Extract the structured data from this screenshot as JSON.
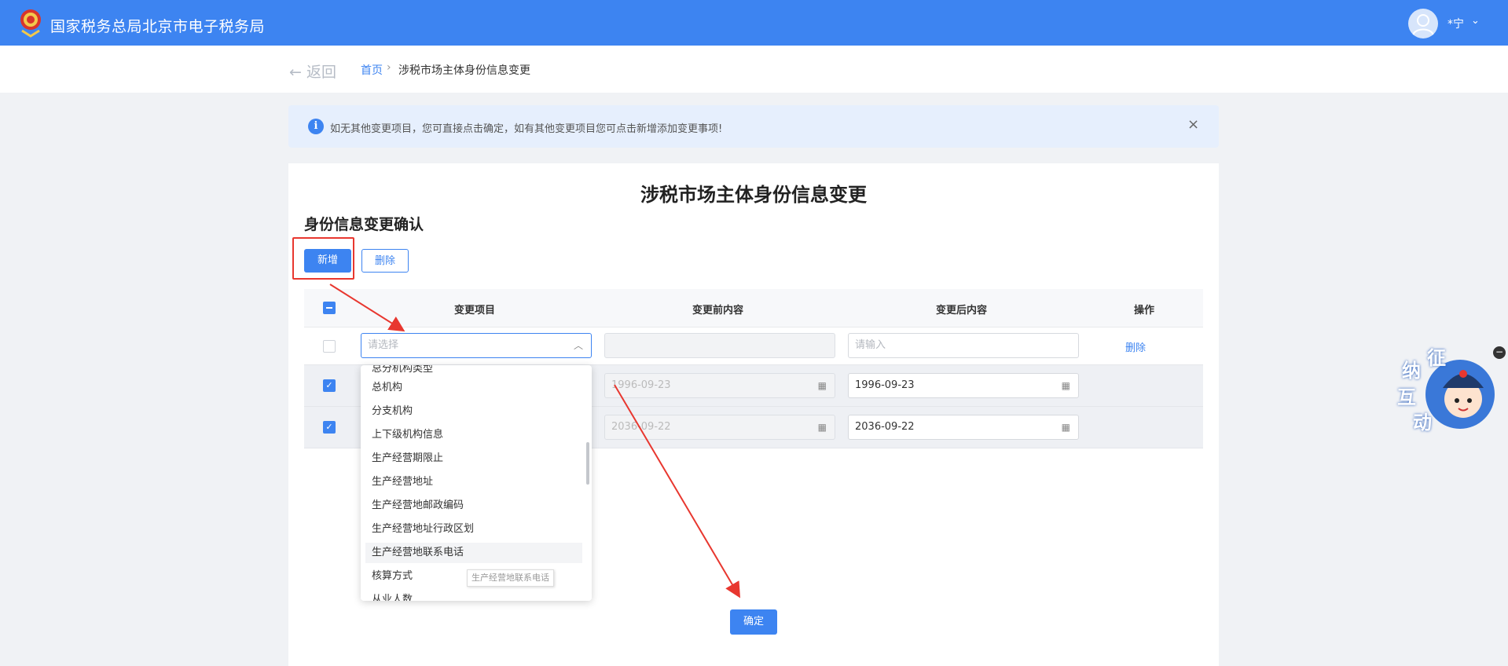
{
  "header": {
    "site_title": "国家税务总局北京市电子税务局",
    "user_name": "*宁",
    "chevron": "⌄",
    "brand_color": "#3d84f1"
  },
  "breadcrumb": {
    "back_label": "← 返回",
    "home": "首页",
    "separator": "›",
    "current": "涉税市场主体身份信息变更"
  },
  "notice": {
    "icon": "i",
    "text": "如无其他变更项目，您可直接点击确定，如有其他变更项目您可点击新增添加变更事项!",
    "close": "×"
  },
  "card": {
    "title": "涉税市场主体身份信息变更",
    "section_title": "身份信息变更确认",
    "add_button": "新增",
    "delete_button": "删除",
    "confirm_button": "确定"
  },
  "table": {
    "headers": [
      "变更项目",
      "变更前内容",
      "变更后内容",
      "操作"
    ],
    "row_new": {
      "select_placeholder": "请选择",
      "after_placeholder": "请输入",
      "action": "删除"
    },
    "rows": [
      {
        "checked": true,
        "before": "1996-09-23",
        "after": "1996-09-23"
      },
      {
        "checked": true,
        "before": "2036-09-22",
        "after": "2036-09-22"
      }
    ]
  },
  "dropdown": {
    "items": [
      "总分机构类型",
      "总机构",
      "分支机构",
      "上下级机构信息",
      "生产经营期限止",
      "生产经营地址",
      "生产经营地邮政编码",
      "生产经营地址行政区划",
      "生产经营地联系电话",
      "核算方式",
      "从业人数"
    ],
    "hovered_index": 8,
    "tooltip": "生产经营地联系电话"
  },
  "assistant": {
    "label_chars": [
      "征",
      "纳",
      "互",
      "动"
    ],
    "close": "−"
  },
  "icons": {
    "calendar": "calendar-icon",
    "chevron_up": "chevron-up-icon",
    "info": "info-icon"
  }
}
